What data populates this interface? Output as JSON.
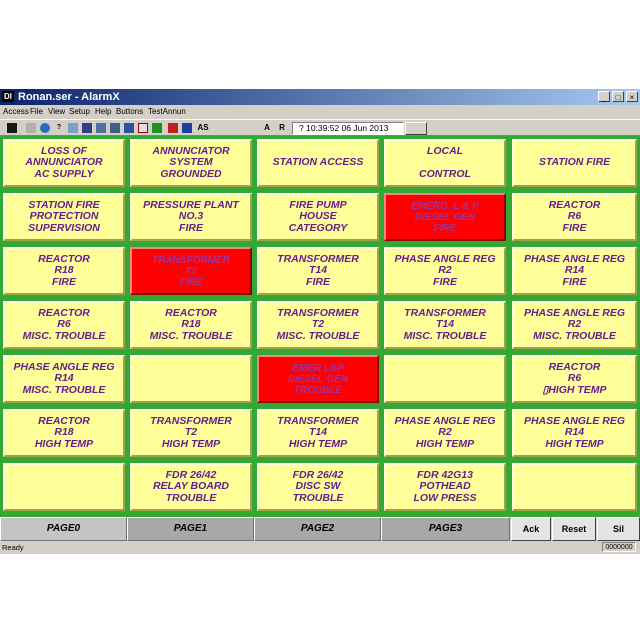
{
  "window": {
    "title": "Ronan.ser - AlarmX",
    "app_icon": "DI"
  },
  "menu": [
    "Access",
    "File",
    "View",
    "Setup",
    "Help",
    "Buttons",
    "TestAnnun"
  ],
  "toolbar": {
    "letters": [
      "AS",
      "A",
      "R"
    ],
    "clock": "? 10:39:52  06 Jun 2013"
  },
  "colors": {
    "tile_normal": "#ffff99",
    "tile_alarm": "#ff0000",
    "grid_bg": "#33a833",
    "tile_text": "#661e8c"
  },
  "tiles": [
    {
      "text": "LOSS OF\nANNUNCIATOR\nAC SUPPLY",
      "state": "normal"
    },
    {
      "text": "ANNUNCIATOR\nSYSTEM\nGROUNDED",
      "state": "normal"
    },
    {
      "text": "STATION ACCESS",
      "state": "normal"
    },
    {
      "text": "LOCAL\n\nCONTROL",
      "state": "normal"
    },
    {
      "text": "STATION FIRE",
      "state": "normal"
    },
    {
      "text": "STATION FIRE\nPROTECTION\nSUPERVISION",
      "state": "normal"
    },
    {
      "text": "PRESSURE PLANT\nNO.3\nFIRE",
      "state": "normal"
    },
    {
      "text": "FIRE PUMP\nHOUSE\nCATEGORY",
      "state": "normal"
    },
    {
      "text": "EMERG. L & P\nDIESEL GEN\nFIRE",
      "state": "alarm"
    },
    {
      "text": "REACTOR\nR6\nFIRE",
      "state": "normal"
    },
    {
      "text": "REACTOR\nR18\nFIRE",
      "state": "normal"
    },
    {
      "text": "TRANSFORMER\nT2\nFIRE",
      "state": "alarm"
    },
    {
      "text": "TRANSFORMER\nT14\nFIRE",
      "state": "normal"
    },
    {
      "text": "PHASE ANGLE REG\nR2\nFIRE",
      "state": "normal"
    },
    {
      "text": "PHASE ANGLE REG\nR14\nFIRE",
      "state": "normal"
    },
    {
      "text": "REACTOR\nR6\nMISC. TROUBLE",
      "state": "normal"
    },
    {
      "text": "REACTOR\nR18\nMISC. TROUBLE",
      "state": "normal"
    },
    {
      "text": "TRANSFORMER\nT2\nMISC. TROUBLE",
      "state": "normal"
    },
    {
      "text": "TRANSFORMER\nT14\nMISC. TROUBLE",
      "state": "normal"
    },
    {
      "text": "PHASE ANGLE REG\nR2\nMISC. TROUBLE",
      "state": "normal"
    },
    {
      "text": "PHASE ANGLE REG\nR14\nMISC. TROUBLE",
      "state": "normal"
    },
    {
      "text": "",
      "state": "normal"
    },
    {
      "text": "EMER L&P\nDIESEL GEN\nTROUBLE",
      "state": "alarm"
    },
    {
      "text": "",
      "state": "normal"
    },
    {
      "text": "REACTOR\nR6\n▯HIGH TEMP",
      "state": "normal"
    },
    {
      "text": "REACTOR\nR18\nHIGH TEMP",
      "state": "normal"
    },
    {
      "text": "TRANSFORMER\nT2\nHIGH TEMP",
      "state": "normal"
    },
    {
      "text": "TRANSFORMER\nT14\nHIGH TEMP",
      "state": "normal"
    },
    {
      "text": "PHASE ANGLE REG\nR2\nHIGH TEMP",
      "state": "normal"
    },
    {
      "text": "PHASE ANGLE REG\nR14\nHIGH TEMP",
      "state": "normal"
    },
    {
      "text": "",
      "state": "normal"
    },
    {
      "text": "FDR 26/42\nRELAY BOARD\nTROUBLE",
      "state": "normal"
    },
    {
      "text": "FDR 26/42\nDISC SW\nTROUBLE",
      "state": "normal"
    },
    {
      "text": "FDR 42G13\nPOTHEAD\nLOW PRESS",
      "state": "normal"
    },
    {
      "text": "",
      "state": "normal"
    }
  ],
  "pages": [
    {
      "label": "PAGE0",
      "active": false
    },
    {
      "label": "PAGE1",
      "active": true
    },
    {
      "label": "PAGE2",
      "active": true
    },
    {
      "label": "PAGE3",
      "active": true
    }
  ],
  "controls": {
    "ack": "Ack",
    "reset": "Reset",
    "sil": "Sil"
  },
  "status": {
    "ready": "Ready",
    "counter": "0000000"
  }
}
